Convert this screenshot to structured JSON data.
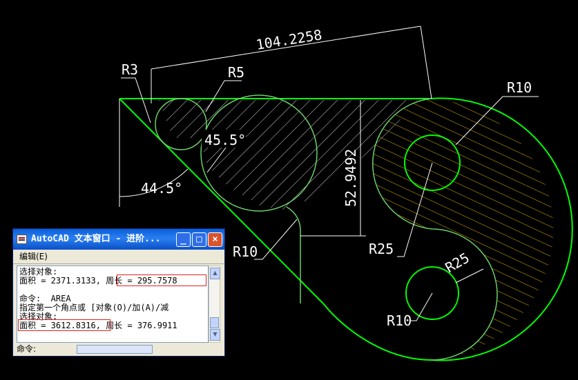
{
  "drawing": {
    "dimensions": {
      "length_top": "104.2258",
      "vertical": "52.9492",
      "angle_outer": "44.5°",
      "angle_inner": "45.5°"
    },
    "radii": {
      "r3": "R3",
      "r5": "R5",
      "r10_top": "R10",
      "r10_left": "R10",
      "r25_upper": "R25",
      "r25_lower": "R25",
      "r10_bottom": "R10"
    },
    "colors": {
      "background": "#000000",
      "outline": "#00ff00",
      "hatch_left": "#ffffff",
      "hatch_right": "#e6b800",
      "leader": "#ffffff"
    }
  },
  "text_window": {
    "title": "AutoCAD 文本窗口 - 进阶...",
    "menu_edit": "编辑(E)",
    "lines": [
      "选择对象:",
      "面积 = 2371.3133, 周长 = 295.7578",
      "",
      "命令:  AREA",
      "指定第一个角点或 [对象(O)/加(A)/减",
      "选择对象:",
      "面积 = 3612.8316, 周长 = 376.9911"
    ],
    "command_prompt": "命令:",
    "buttons": {
      "minimize": "_",
      "maximize": "□",
      "close": "×"
    }
  }
}
